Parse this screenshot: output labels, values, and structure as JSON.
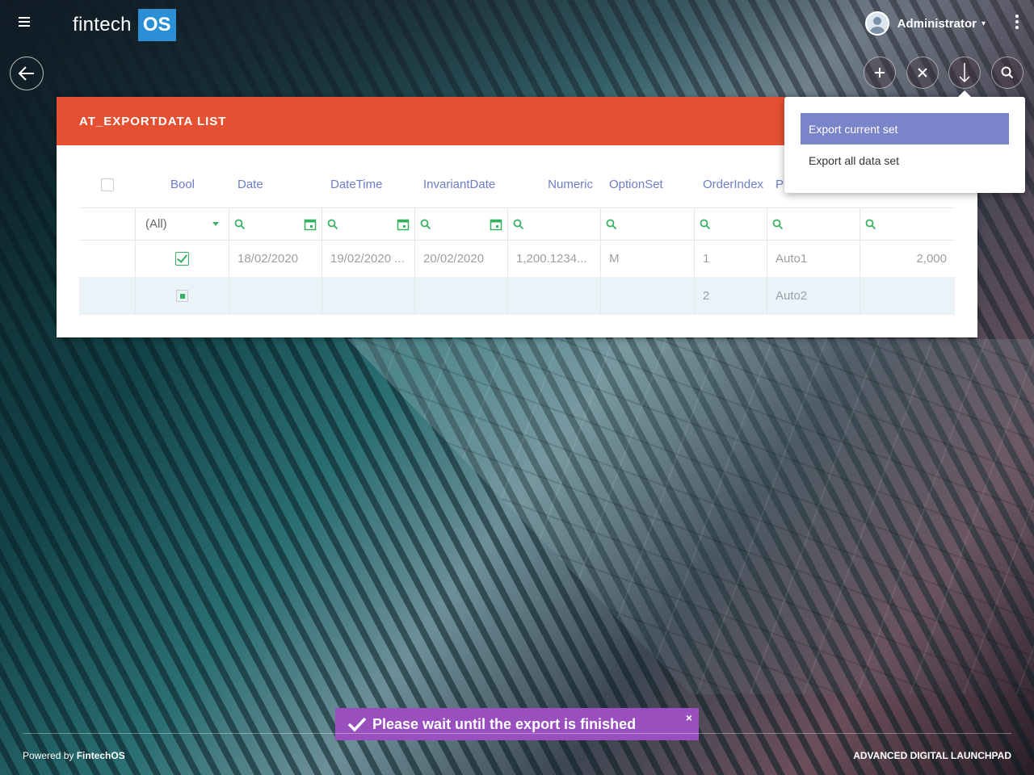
{
  "header": {
    "logo_text": "fintech",
    "logo_badge": "OS",
    "user_name": "Administrator"
  },
  "panel": {
    "title": "AT_EXPORTDATA LIST"
  },
  "grid": {
    "columns": [
      "Bool",
      "Date",
      "DateTime",
      "InvariantDate",
      "Numeric",
      "OptionSet",
      "OrderIndex",
      "P"
    ],
    "bool_filter": "(All)",
    "rows": [
      {
        "bool": "checked",
        "date": "18/02/2020",
        "datetime": "19/02/2020 ...",
        "invariant": "20/02/2020",
        "numeric": "1,200.1234...",
        "option": "M",
        "order": "1",
        "p": "Auto1",
        "last": "2,000"
      },
      {
        "bool": "indeterminate",
        "date": "",
        "datetime": "",
        "invariant": "",
        "numeric": "",
        "option": "",
        "order": "2",
        "p": "Auto2",
        "last": ""
      }
    ]
  },
  "export_menu": {
    "items": [
      {
        "label": "Export current set",
        "active": true
      },
      {
        "label": "Export all data set",
        "active": false
      }
    ]
  },
  "toast": {
    "message": "Please wait until the export is finished",
    "close": "×"
  },
  "footer": {
    "powered_prefix": "Powered by",
    "powered_brand": "FintechOS",
    "right_text": "ADVANCED DIGITAL LAUNCHPAD"
  },
  "colors": {
    "panel_header": "#e65032",
    "accent_blue": "#6d7ec8",
    "accent_green": "#35b15f",
    "menu_active": "#7a84c9",
    "toast": "#9a4fbf"
  }
}
